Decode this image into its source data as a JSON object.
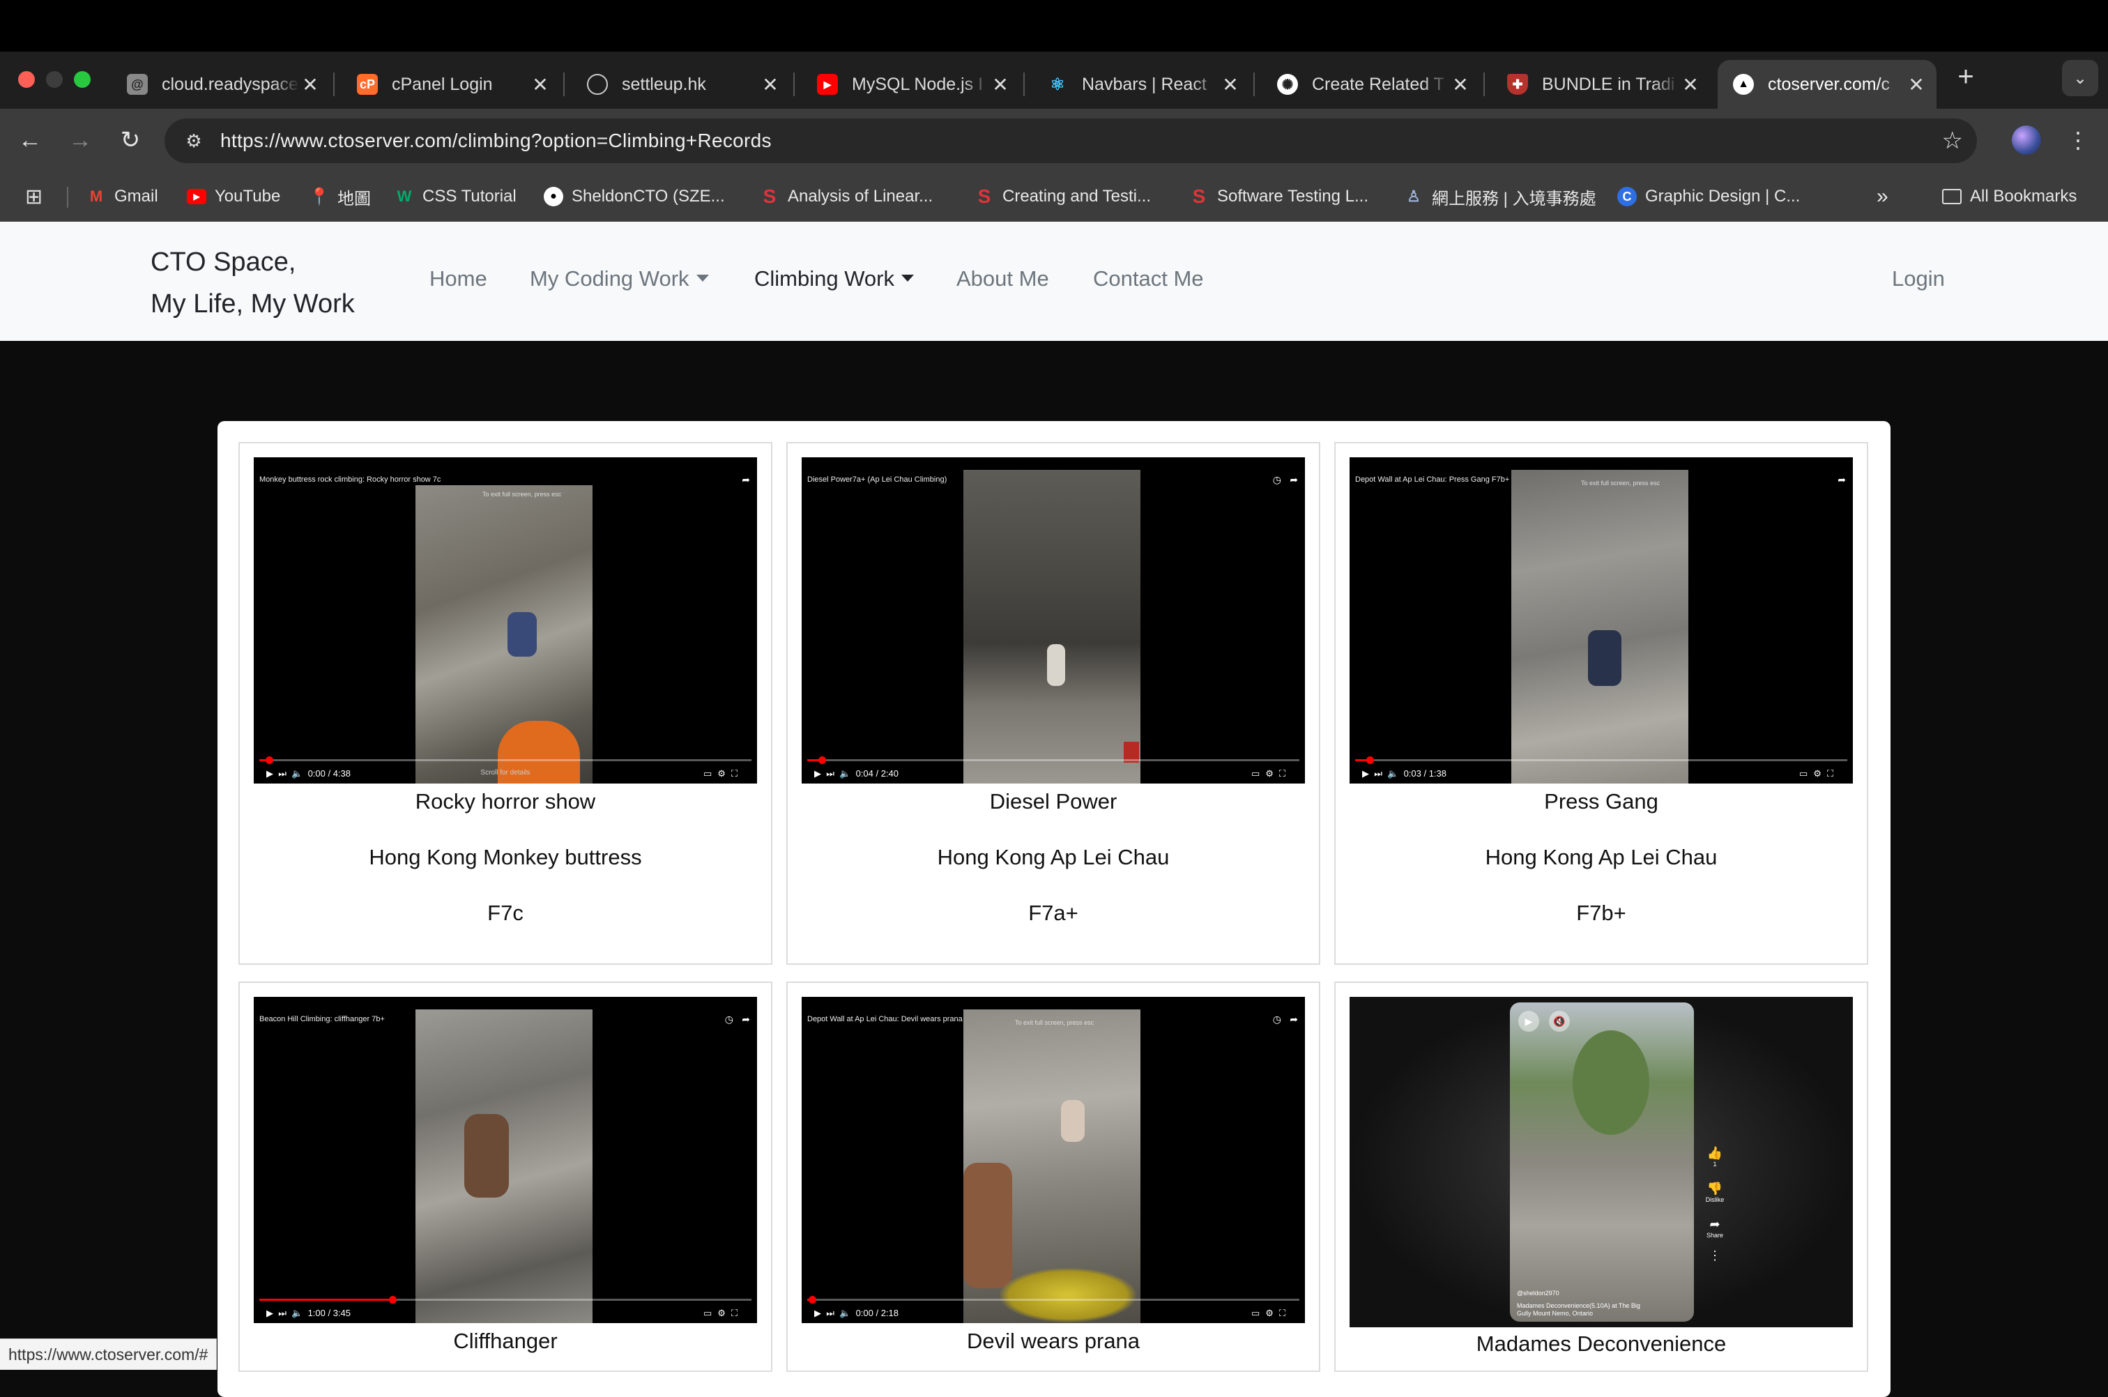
{
  "browser": {
    "tabs": [
      {
        "title": "cloud.readyspace",
        "favicon": "at-sign-icon"
      },
      {
        "title": "cPanel Login",
        "favicon": "cpanel-icon"
      },
      {
        "title": "settleup.hk",
        "favicon": "globe-icon"
      },
      {
        "title": "MySQL Node.js I",
        "favicon": "youtube-icon"
      },
      {
        "title": "Navbars | React",
        "favicon": "react-bootstrap-icon"
      },
      {
        "title": "Create Related T",
        "favicon": "openai-icon"
      },
      {
        "title": "BUNDLE in Tradi",
        "favicon": "shield-icon"
      },
      {
        "title": "ctoserver.com/c",
        "favicon": "triangle-icon",
        "active": true
      }
    ],
    "url": "https://www.ctoserver.com/climbing?option=Climbing+Records",
    "bookmarks": [
      {
        "label": "Gmail",
        "icon": "gmail-icon"
      },
      {
        "label": "YouTube",
        "icon": "youtube-icon"
      },
      {
        "label": "地圖",
        "icon": "maps-icon"
      },
      {
        "label": "CSS Tutorial",
        "icon": "w3schools-icon"
      },
      {
        "label": "SheldonCTO (SZE...",
        "icon": "github-icon"
      },
      {
        "label": "Analysis of Linear...",
        "icon": "scribd-icon"
      },
      {
        "label": "Creating and Testi...",
        "icon": "scribd-icon"
      },
      {
        "label": "Software Testing L...",
        "icon": "scribd-icon"
      },
      {
        "label": "網上服務 | 入境事務處",
        "icon": "immigration-icon"
      },
      {
        "label": "Graphic Design | C...",
        "icon": "canva-icon"
      }
    ],
    "all_bookmarks_label": "All Bookmarks",
    "overflow_label": "»",
    "status_url": "https://www.ctoserver.com/#",
    "colors": {
      "tab_strip": "#1f1f1f",
      "toolbar": "#3c3c3c",
      "omnibox": "#282828"
    }
  },
  "site": {
    "brand_line1": "CTO Space,",
    "brand_line2": "My Life, My Work",
    "nav": {
      "home": "Home",
      "coding": "My Coding Work",
      "climbing": "Climbing Work",
      "about": "About Me",
      "contact": "Contact Me",
      "login": "Login"
    },
    "climbs": [
      {
        "video_title": "Monkey buttress rock climbing: Rocky horror show 7c",
        "time": "0:00 / 4:38",
        "progress": 0.02,
        "name": "Rocky horror show",
        "location": "Hong Kong Monkey buttress",
        "grade": "F7c"
      },
      {
        "video_title": "Diesel Power7a+ (Ap Lei Chau Climbing)",
        "time": "0:04 / 2:40",
        "progress": 0.03,
        "name": "Diesel Power",
        "location": "Hong Kong Ap Lei Chau",
        "grade": "F7a+"
      },
      {
        "video_title": "Depot Wall at Ap Lei Chau: Press Gang F7b+",
        "time": "0:03 / 1:38",
        "progress": 0.03,
        "name": "Press Gang",
        "location": "Hong Kong Ap Lei Chau",
        "grade": "F7b+"
      },
      {
        "video_title": "Beacon Hill Climbing: cliffhanger 7b+",
        "time": "1:00 / 3:45",
        "progress": 0.27,
        "name": "Cliffhanger",
        "location": "",
        "grade": ""
      },
      {
        "video_title": "Depot Wall at Ap Lei Chau: Devil wears prana",
        "time": "0:00 / 2:18",
        "progress": 0.01,
        "name": "Devil wears prana",
        "location": "",
        "grade": ""
      },
      {
        "video_title": "",
        "time": "",
        "progress": 0,
        "name": "Madames Deconvenience",
        "location": "",
        "grade": "",
        "short": true,
        "short_channel": "@sheldon2970",
        "short_caption": "Madames Deconvenience(5.10A) at The Big Gully Mount Nemo, Ontario",
        "like_count": "1",
        "dislike_label": "Dislike",
        "share_label": "Share"
      }
    ],
    "video_overlay": {
      "fullscreen_hint": "To exit full screen, press",
      "esc_key": "esc",
      "scroll_hint": "Scroll for details"
    }
  }
}
